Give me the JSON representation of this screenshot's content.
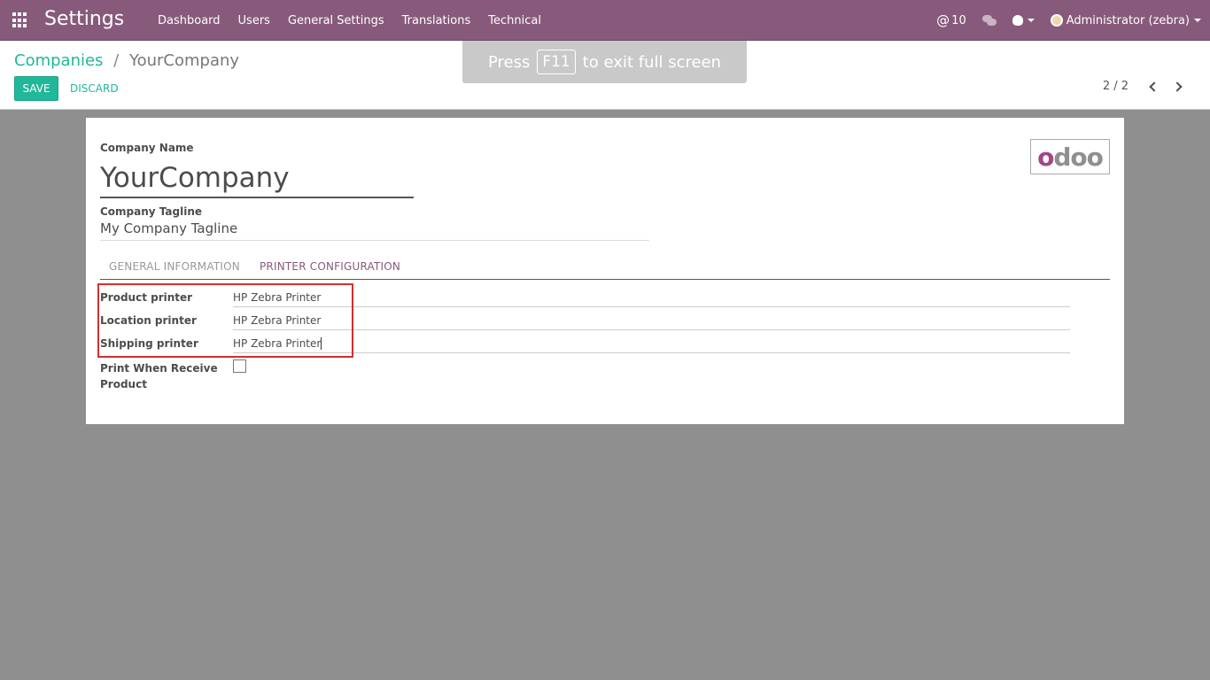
{
  "navbar": {
    "app_title": "Settings",
    "menu": [
      "Dashboard",
      "Users",
      "General Settings",
      "Translations",
      "Technical"
    ],
    "mentions_count": "10",
    "user_label": "Administrator (zebra)"
  },
  "control_panel": {
    "breadcrumb_parent": "Companies",
    "breadcrumb_separator": "/",
    "breadcrumb_current": "YourCompany",
    "save_label": "SAVE",
    "discard_label": "DISCARD",
    "pager": "2 / 2"
  },
  "fullscreen_notice": {
    "before": "Press",
    "key": "F11",
    "after": "to exit full screen"
  },
  "form": {
    "company_name_label": "Company Name",
    "company_name": "YourCompany",
    "tagline_label": "Company Tagline",
    "tagline": "My Company Tagline",
    "logo_first": "o",
    "logo_rest": "doo",
    "tabs": [
      "GENERAL INFORMATION",
      "PRINTER CONFIGURATION"
    ],
    "fields": {
      "product_printer_label": "Product printer",
      "product_printer": "HP Zebra Printer",
      "location_printer_label": "Location printer",
      "location_printer": "HP Zebra Printer",
      "shipping_printer_label": "Shipping printer",
      "shipping_printer": "HP Zebra Printer",
      "print_receive_label_1": "Print When Receive",
      "print_receive_label_2": "Product",
      "print_receive_checked": false
    }
  },
  "colors": {
    "navbar": "#875a7b",
    "accent": "#21b799",
    "highlight": "#d32f2f"
  }
}
